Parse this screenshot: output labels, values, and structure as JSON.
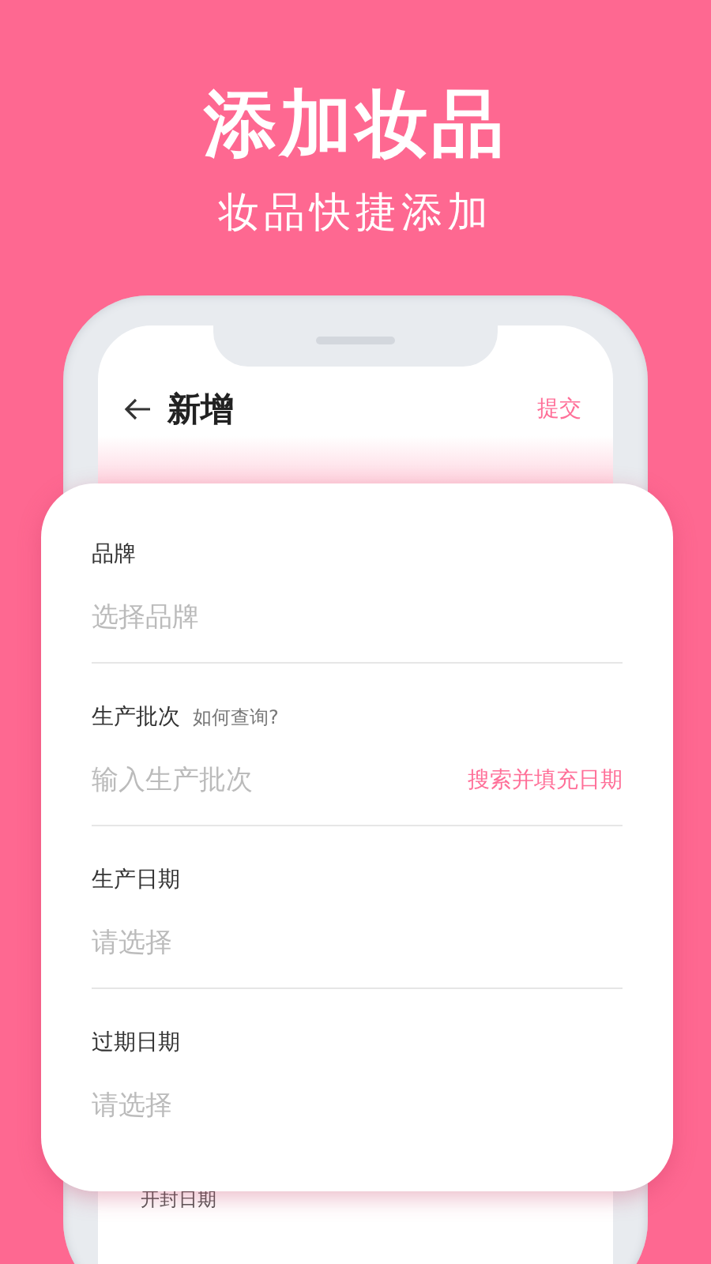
{
  "headline": "添加妆品",
  "subheadline": "妆品快捷添加",
  "phone": {
    "header": {
      "title": "新增",
      "action": "提交"
    },
    "peek_label": "开封日期"
  },
  "form": {
    "fields": [
      {
        "label": "品牌",
        "placeholder": "选择品牌"
      },
      {
        "label": "生产批次",
        "hint": "如何查询?",
        "placeholder": "输入生产批次",
        "action": "搜索并填充日期"
      },
      {
        "label": "生产日期",
        "placeholder": "请选择"
      },
      {
        "label": "过期日期",
        "placeholder": "请选择"
      }
    ]
  }
}
